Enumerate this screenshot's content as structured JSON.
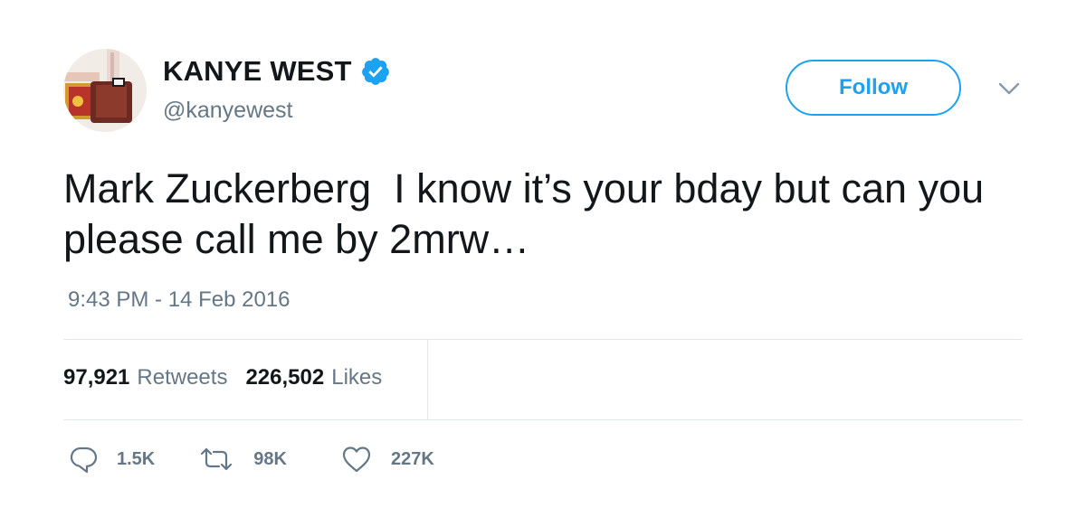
{
  "header": {
    "display_name": "KANYE WEST",
    "handle": "@kanyewest",
    "verified_icon": "verified-badge-icon",
    "follow_label": "Follow",
    "menu_icon": "chevron-down-icon"
  },
  "tweet": {
    "text": "Mark Zuckerberg  I know it’s your bday but can you please call me by 2mrw…",
    "timestamp": "9:43 PM - 14 Feb 2016"
  },
  "stats": {
    "retweets_count": "97,921",
    "retweets_label": "Retweets",
    "likes_count": "226,502",
    "likes_label": "Likes"
  },
  "actions": {
    "reply_count": "1.5K",
    "retweet_count": "98K",
    "like_count": "227K"
  },
  "colors": {
    "accent": "#1da1f2",
    "text": "#14171a",
    "secondary": "#657786",
    "divider": "#e1e8ed"
  }
}
